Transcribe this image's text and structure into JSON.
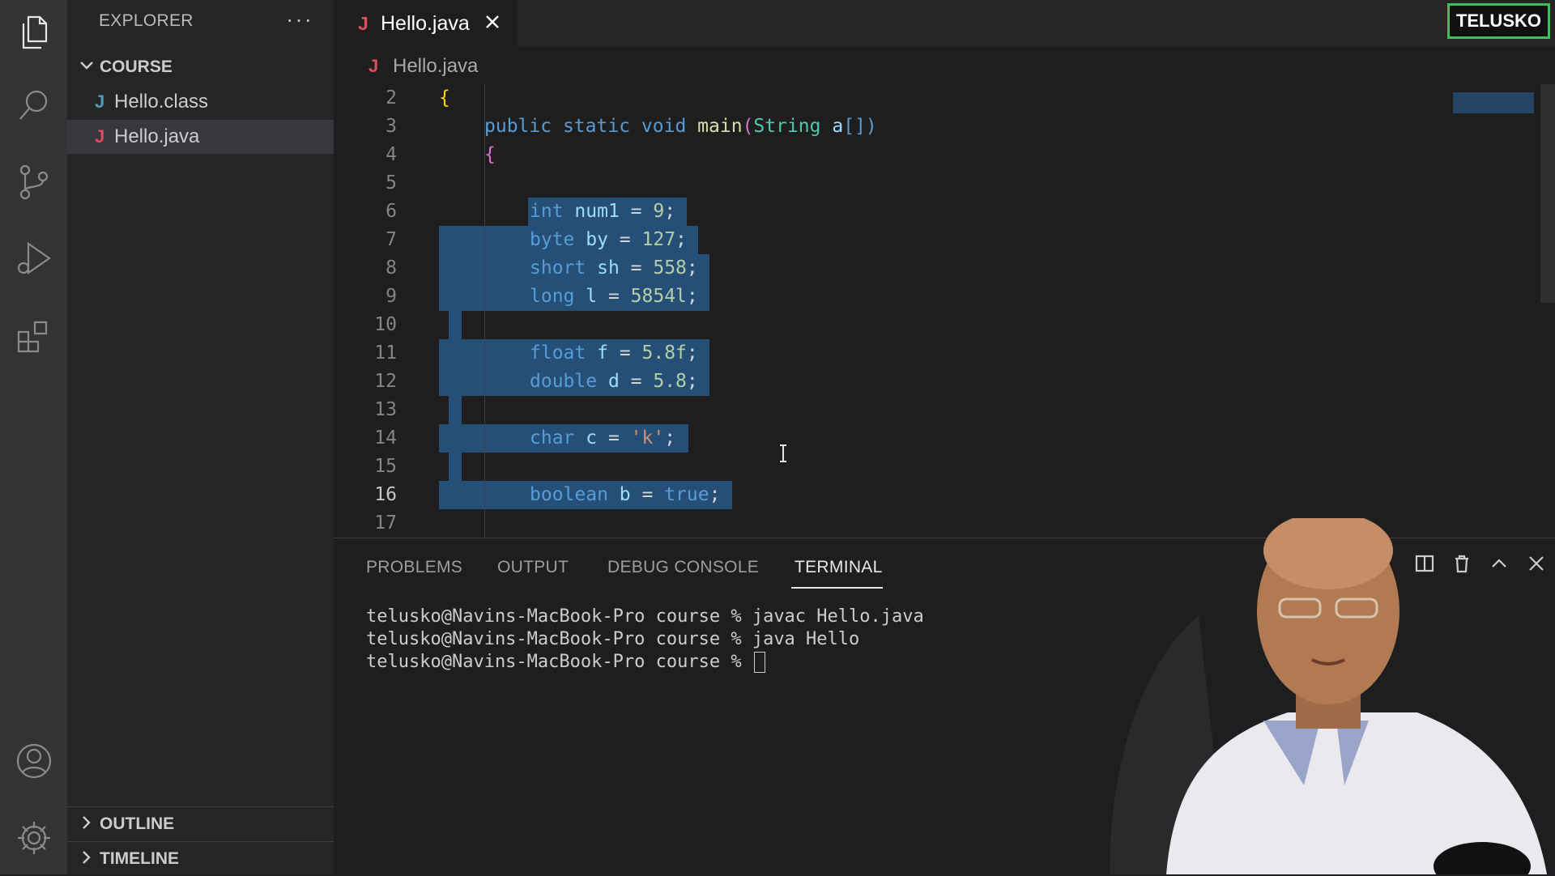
{
  "activity_bar": {
    "items": [
      "explorer-icon",
      "search-icon",
      "source-control-icon",
      "run-debug-icon",
      "extensions-icon"
    ],
    "bottom": [
      "account-icon",
      "settings-icon"
    ]
  },
  "sidebar": {
    "title": "EXPLORER",
    "more": "···",
    "folder": "COURSE",
    "files": [
      {
        "icon": "J",
        "name": "Hello.class",
        "color": "#519aba"
      },
      {
        "icon": "J",
        "name": "Hello.java",
        "color": "#e04b5d"
      }
    ],
    "outline": "OUTLINE",
    "timeline": "TIMELINE"
  },
  "tab": {
    "icon": "J",
    "label": "Hello.java"
  },
  "brand": "TELUSKO",
  "breadcrumb": {
    "icon": "J",
    "file": "Hello.java"
  },
  "editor": {
    "line_numbers": [
      "2",
      "3",
      "4",
      "5",
      "6",
      "7",
      "8",
      "9",
      "10",
      "11",
      "12",
      "13",
      "14",
      "15",
      "16",
      "17"
    ],
    "current_line": "16",
    "lines": {
      "l2": "{",
      "l3": {
        "public": "public",
        "static": "static",
        "void": "void",
        "main": "main",
        "open": "(",
        "String": "String",
        "a": "a",
        "close": "[])"
      },
      "l4": "{",
      "l6": {
        "type": "int",
        "name": "num1",
        "eq": " = ",
        "val": "9",
        "end": ";"
      },
      "l7": {
        "type": "byte",
        "name": "by",
        "eq": " = ",
        "val": "127",
        "end": ";"
      },
      "l8": {
        "type": "short",
        "name": "sh",
        "eq": " = ",
        "val": "558",
        "end": ";"
      },
      "l9": {
        "type": "long",
        "name": "l",
        "eq": " = ",
        "val": "5854l",
        "end": ";"
      },
      "l11": {
        "type": "float",
        "name": "f",
        "eq": " = ",
        "val": "5.8f",
        "end": ";"
      },
      "l12": {
        "type": "double",
        "name": "d",
        "eq": " = ",
        "val": "5.8",
        "end": ";"
      },
      "l14": {
        "type": "char",
        "name": "c",
        "eq": " = ",
        "val": "'k'",
        "end": ";"
      },
      "l16": {
        "type": "boolean",
        "name": "b",
        "eq": " = ",
        "val": "true",
        "end": ";"
      }
    }
  },
  "panel": {
    "tabs": [
      "PROBLEMS",
      "OUTPUT",
      "DEBUG CONSOLE",
      "TERMINAL"
    ],
    "active_tab": "TERMINAL",
    "terminal": [
      "telusko@Navins-MacBook-Pro course % javac Hello.java",
      "telusko@Navins-MacBook-Pro course % java Hello",
      "telusko@Navins-MacBook-Pro course % "
    ]
  }
}
